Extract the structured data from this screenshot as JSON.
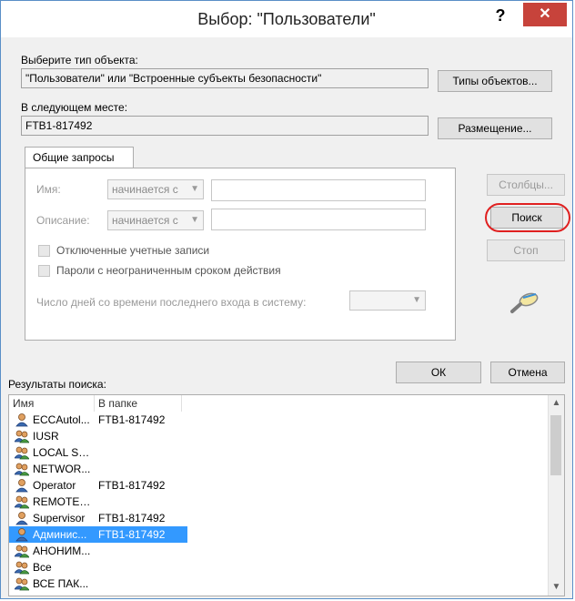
{
  "window": {
    "title": "Выбор: \"Пользователи\"",
    "help_label": "?",
    "close_label": "✕"
  },
  "object_type": {
    "label": "Выберите тип объекта:",
    "value": "\"Пользователи\" или \"Встроенные субъекты безопасности\"",
    "button": "Типы объектов..."
  },
  "location": {
    "label": "В следующем месте:",
    "value": "FTB1-817492",
    "button": "Размещение..."
  },
  "tab": {
    "label": "Общие запросы"
  },
  "query": {
    "name_label": "Имя:",
    "name_mode": "начинается с",
    "desc_label": "Описание:",
    "desc_mode": "начинается с",
    "disabled_accounts": "Отключенные учетные записи",
    "no_expire_passwords": "Пароли с неограниченным сроком действия",
    "days_since_logon": "Число дней со времени последнего входа в систему:"
  },
  "side_buttons": {
    "columns": "Столбцы...",
    "search": "Поиск",
    "stop": "Стоп"
  },
  "footer": {
    "ok": "ОК",
    "cancel": "Отмена"
  },
  "results": {
    "label": "Результаты поиска:",
    "columns": [
      "Имя",
      "В папке"
    ],
    "rows": [
      {
        "name": "ECCAutol...",
        "folder": "FTB1-817492",
        "icon": "user-icon"
      },
      {
        "name": "IUSR",
        "folder": "",
        "icon": "group-icon"
      },
      {
        "name": "LOCAL SE...",
        "folder": "",
        "icon": "group-icon"
      },
      {
        "name": "NETWOR...",
        "folder": "",
        "icon": "group-icon"
      },
      {
        "name": "Operator",
        "folder": "FTB1-817492",
        "icon": "user-icon"
      },
      {
        "name": "REMOTE ...",
        "folder": "",
        "icon": "group-icon"
      },
      {
        "name": "Supervisor",
        "folder": "FTB1-817492",
        "icon": "user-icon"
      },
      {
        "name": "Админис...",
        "folder": "FTB1-817492",
        "icon": "user-icon",
        "selected": true
      },
      {
        "name": "АНОНИМ...",
        "folder": "",
        "icon": "group-icon"
      },
      {
        "name": "Все",
        "folder": "",
        "icon": "group-icon"
      },
      {
        "name": "ВСЕ ПАК...",
        "folder": "",
        "icon": "group-icon"
      }
    ]
  },
  "colors": {
    "selection": "#3399ff",
    "close_button": "#c7433b",
    "highlight_ring": "#e02020"
  }
}
